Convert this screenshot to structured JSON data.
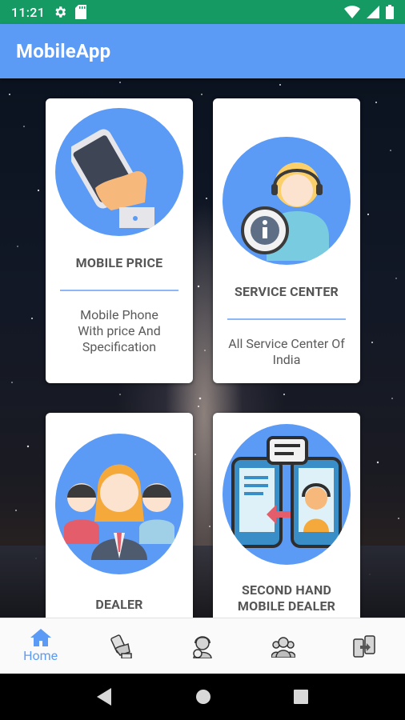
{
  "status_bar": {
    "time": "11:21",
    "icons": [
      "gear-icon",
      "sd-card-icon",
      "wifi-icon",
      "signal-icon",
      "battery-icon"
    ]
  },
  "app_bar": {
    "title": "MobileApp"
  },
  "cards": [
    {
      "title": "MOBILE PRICE",
      "desc_line1": "Mobile Phone",
      "desc_line2": "With price And",
      "desc_line3": "Specification",
      "icon": "hand-holding-phone-icon"
    },
    {
      "title": "SERVICE CENTER",
      "desc_line1": "All Service Center Of",
      "desc_line2": "India",
      "icon": "support-agent-info-icon"
    },
    {
      "title": "DEALER",
      "icon": "dealer-people-icon"
    },
    {
      "title_line1": "SECOND HAND",
      "title_line2": "MOBILE DEALER",
      "icon": "phone-chat-exchange-icon"
    }
  ],
  "bottom_nav": {
    "items": [
      {
        "label": "Home",
        "icon": "home-icon",
        "active": true
      },
      {
        "label": "",
        "icon": "hand-phone-icon",
        "active": false
      },
      {
        "label": "",
        "icon": "support-agent-icon",
        "active": false
      },
      {
        "label": "",
        "icon": "group-icon",
        "active": false
      },
      {
        "label": "",
        "icon": "phone-exchange-icon",
        "active": false
      }
    ]
  },
  "system_nav": {
    "icons": [
      "back-icon",
      "home-circle-icon",
      "recents-icon"
    ]
  },
  "colors": {
    "status_bar": "#169a64",
    "app_bar": "#5b9bf6",
    "accent": "#5b9bf6",
    "divider": "#8db8f8"
  }
}
